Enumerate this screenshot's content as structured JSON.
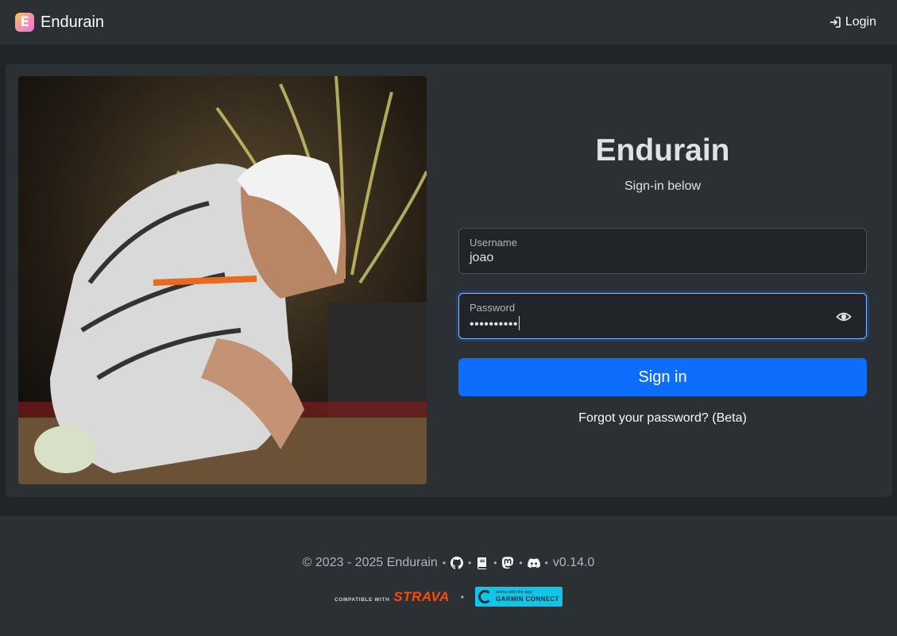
{
  "navbar": {
    "brand_letter": "E",
    "brand_name": "Endurain",
    "login_label": "Login"
  },
  "hero_image": {
    "description_icon": "athlete-photo"
  },
  "form": {
    "title": "Endurain",
    "subtitle": "Sign-in below",
    "username": {
      "label": "Username",
      "value": "joao"
    },
    "password": {
      "label": "Password",
      "value": "••••••••••"
    },
    "signin_label": "Sign in",
    "forgot_label": "Forgot your password? (Beta)"
  },
  "footer": {
    "copyright": "© 2023 - 2025 Endurain",
    "version": "v0.14.0",
    "strava_prefix": "COMPATIBLE WITH",
    "strava_word": "STRAVA",
    "garmin_small": "works with the app",
    "garmin_big": "GARMIN CONNECT"
  },
  "colors": {
    "primary": "#0d6efd",
    "background": "#212529",
    "surface": "#2b3035",
    "strava": "#fc4c02",
    "garmin": "#11c5e8"
  }
}
